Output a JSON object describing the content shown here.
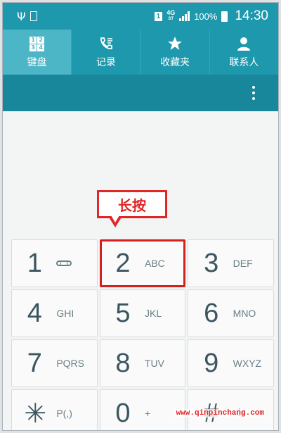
{
  "status_bar": {
    "usb_icon": "usb-icon",
    "sd_icon": "sd-card-icon",
    "sim_slot": "1",
    "network": "4G",
    "network_sub": "ST",
    "battery_percent": "100%",
    "time": "14:30"
  },
  "tabs": [
    {
      "label": "键盘",
      "icon": "keypad-icon",
      "active": true
    },
    {
      "label": "记录",
      "icon": "call-log-icon",
      "active": false
    },
    {
      "label": "收藏夹",
      "icon": "star-icon",
      "active": false
    },
    {
      "label": "联系人",
      "icon": "person-icon",
      "active": false
    }
  ],
  "keypad_icon_digits": [
    "1",
    "2",
    "3",
    "4"
  ],
  "callout": {
    "text": "长按"
  },
  "keys": [
    {
      "digit": "1",
      "letters": "",
      "icon": "voicemail-icon"
    },
    {
      "digit": "2",
      "letters": "ABC",
      "highlight": true
    },
    {
      "digit": "3",
      "letters": "DEF"
    },
    {
      "digit": "4",
      "letters": "GHI"
    },
    {
      "digit": "5",
      "letters": "JKL"
    },
    {
      "digit": "6",
      "letters": "MNO"
    },
    {
      "digit": "7",
      "letters": "PQRS"
    },
    {
      "digit": "8",
      "letters": "TUV"
    },
    {
      "digit": "9",
      "letters": "WXYZ"
    },
    {
      "digit": "✳",
      "letters": "P(,)"
    },
    {
      "digit": "0",
      "letters": "+"
    },
    {
      "digit": "#",
      "letters": "",
      "icon": "mute-icon"
    }
  ],
  "watermark": "www.qinpinchang.com",
  "colors": {
    "header": "#1e98ad",
    "active_tab": "#4db6c6",
    "actionbar": "#18879b",
    "callout": "#e02626"
  }
}
